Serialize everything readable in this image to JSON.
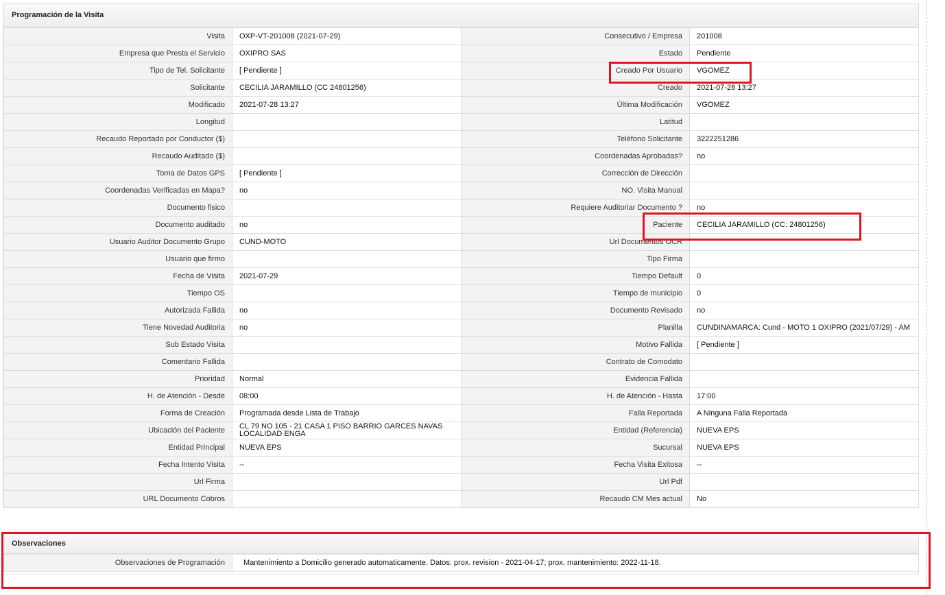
{
  "main": {
    "title": "Programación de la Visita",
    "rows": [
      {
        "l1": "Visita",
        "v1": "OXP-VT-201008 (2021-07-29)",
        "l2": "Consecutivo / Empresa",
        "v2": "201008"
      },
      {
        "l1": "Empresa que Presta el Servicio",
        "v1": "OXIPRO SAS",
        "l2": "Estado",
        "v2": "Pendiente"
      },
      {
        "l1": "Tipo de Tel. Solicitante",
        "v1": "[ Pendiente ]",
        "l2": "Creado Por Usuario",
        "v2": "VGOMEZ"
      },
      {
        "l1": "Solicitante",
        "v1": "CECILIA JARAMILLO (CC 24801256)",
        "l2": "Creado",
        "v2": "2021-07-28 13:27"
      },
      {
        "l1": "Modificado",
        "v1": "2021-07-28 13:27",
        "l2": "Última Modificación",
        "v2": " VGOMEZ"
      },
      {
        "l1": "Longitud",
        "v1": "",
        "l2": "Latitud",
        "v2": ""
      },
      {
        "l1": "Recaudo Reportado por Conductor ($)",
        "v1": "",
        "l2": "Teléfono Solicitante",
        "v2": "3222251286"
      },
      {
        "l1": "Recaudo Auditado ($)",
        "v1": "",
        "l2": "Coordenadas Aprobadas?",
        "v2": " no"
      },
      {
        "l1": "Toma de Datos GPS",
        "v1": "[ Pendiente ]",
        "l2": "Corrección de Dirección",
        "v2": ""
      },
      {
        "l1": "Coordenadas Verificadas en Mapa?",
        "v1": " no",
        "l2": "NO. Visita Manual",
        "v2": ""
      },
      {
        "l1": "Documento fisico",
        "v1": "",
        "l2": "Requiere Auditoriar Documento ?",
        "v2": " no"
      },
      {
        "l1": "Documento auditado",
        "v1": " no",
        "l2": "Paciente",
        "v2": "CECILIA JARAMILLO (CC: 24801256)"
      },
      {
        "l1": "Usuario Auditor Documento Grupo",
        "v1": "CUND-MOTO",
        "l2": "Url Documentos OCR",
        "v2": ""
      },
      {
        "l1": "Usuario que firmo",
        "v1": "",
        "l2": "Tipo Firma",
        "v2": ""
      },
      {
        "l1": "Fecha de Visita",
        "v1": " 2021-07-29",
        "l2": "Tiempo Default",
        "v2": "0"
      },
      {
        "l1": "Tiempo OS",
        "v1": "",
        "l2": "Tiempo de municipio",
        "v2": "0"
      },
      {
        "l1": "Autorizada Fallida",
        "v1": " no",
        "l2": "Documento Revisado",
        "v2": " no"
      },
      {
        "l1": "Tiene Novedad Auditoria",
        "v1": " no",
        "l2": "Planilla",
        "v2": "CUNDINAMARCA: Cund - MOTO 1 OXIPRO (2021/07/29) - AM"
      },
      {
        "l1": "Sub Estado Visita",
        "v1": "",
        "l2": "Motivo Fallida",
        "v2": "[ Pendiente ]"
      },
      {
        "l1": "Comentario Fallida",
        "v1": "",
        "l2": "Contrato de Comodato",
        "v2": ""
      },
      {
        "l1": "Prioridad",
        "v1": "Normal",
        "l2": "Evidencia Fallida",
        "v2": ""
      },
      {
        "l1": "H. de Atención - Desde",
        "v1": "08:00",
        "l2": "H. de Atención - Hasta",
        "v2": "17:00"
      },
      {
        "l1": "Forma de Creación",
        "v1": "Programada desde Lista de Trabajo",
        "l2": "Falla Reportada",
        "v2": "A Ninguna Falla Reportada"
      },
      {
        "l1": "Ubicación del Paciente",
        "v1": "CL 79 NO 105 - 21 CASA 1 PISO BARRIO GARCES NAVAS LOCALIDAD ENGA",
        "l2": "Entidad (Referencia)",
        "v2": "NUEVA EPS"
      },
      {
        "l1": "Entidad Principal",
        "v1": "NUEVA EPS",
        "l2": "Sucursal",
        "v2": "NUEVA EPS"
      },
      {
        "l1": "Fecha Intento Visita",
        "v1": " --",
        "l2": "Fecha Visita Exitosa",
        "v2": " --"
      },
      {
        "l1": "Url Firma",
        "v1": "",
        "l2": "Url Pdf",
        "v2": ""
      },
      {
        "l1": "URL Documento Cobros",
        "v1": "",
        "l2": "Recaudo CM Mes actual",
        "v2": "No"
      }
    ]
  },
  "observaciones": {
    "title": "Observaciones",
    "label": "Observaciones de Programación",
    "value": "Mantenimiento a Domicilio generado automaticamente. Datos: prox. revision - 2021-04-17; prox. mantenimiento: 2022-11-18."
  },
  "highlight_color": "#e0141e"
}
